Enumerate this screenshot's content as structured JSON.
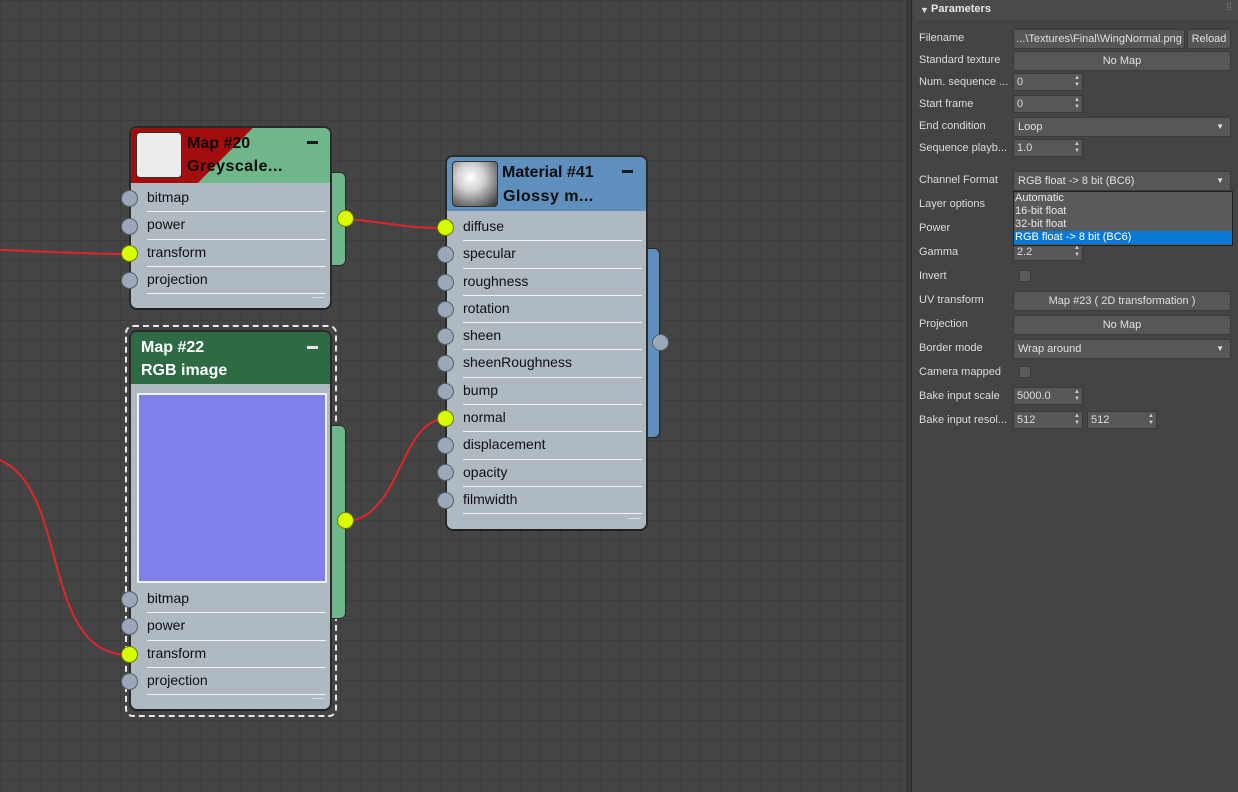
{
  "nodes": {
    "map20": {
      "title": "Map #20",
      "subtitle": "Greyscale...",
      "sockets": [
        "bitmap",
        "power",
        "transform",
        "projection"
      ]
    },
    "map22": {
      "title": "Map #22",
      "subtitle": "RGB image",
      "sockets": [
        "bitmap",
        "power",
        "transform",
        "projection"
      ]
    },
    "material41": {
      "title": "Material #41",
      "subtitle": "Glossy  m...",
      "sockets": [
        "diffuse",
        "specular",
        "roughness",
        "rotation",
        "sheen",
        "sheenRoughness",
        "bump",
        "normal",
        "displacement",
        "opacity",
        "filmwidth"
      ]
    }
  },
  "panel": {
    "rollout_title": "Parameters",
    "rows": {
      "filename": {
        "label": "Filename",
        "value": "...\\Textures\\Final\\WingNormal.png",
        "reload": "Reload"
      },
      "standard_texture": {
        "label": "Standard texture",
        "value": "No Map"
      },
      "num_sequence": {
        "label": "Num. sequence ...",
        "value": "0"
      },
      "start_frame": {
        "label": "Start frame",
        "value": "0"
      },
      "end_condition": {
        "label": "End condition",
        "value": "Loop"
      },
      "sequence_playback": {
        "label": "Sequence playb...",
        "value": "1.0"
      },
      "channel_format": {
        "label": "Channel Format",
        "value": "RGB float -> 8 bit (BC6)"
      },
      "layer_options": {
        "label": "Layer options"
      },
      "power": {
        "label": "Power"
      },
      "gamma": {
        "label": "Gamma",
        "value": "2.2"
      },
      "invert": {
        "label": "Invert"
      },
      "uv_transform": {
        "label": "UV transform",
        "value": "Map #23  ( 2D transformation )"
      },
      "projection": {
        "label": "Projection",
        "value": "No Map"
      },
      "border_mode": {
        "label": "Border mode",
        "value": "Wrap around"
      },
      "camera_mapped": {
        "label": "Camera mapped"
      },
      "bake_input_scale": {
        "label": "Bake input scale",
        "value": "5000.0"
      },
      "bake_input_resolution": {
        "label": "Bake input resol...",
        "value_w": "512",
        "value_h": "512"
      }
    },
    "channel_format_options": [
      "Automatic",
      "16-bit float",
      "32-bit float",
      "RGB float -> 8 bit (BC6)"
    ],
    "channel_format_selected_index": 3
  },
  "colors": {
    "canvas_bg": "#444444",
    "node_body": "#aeb9c2",
    "socket_active": "#d8ff00",
    "socket_idle": "#9aa8b8",
    "wire": "#e0262a",
    "map20_header": "#6fb68a",
    "map20_error": "#a30d0d",
    "map22_header": "#2e6b45",
    "material_header": "#5f8fbd",
    "normal_swatch": "#8080ea",
    "dropdown_selected": "#0a78d7"
  }
}
